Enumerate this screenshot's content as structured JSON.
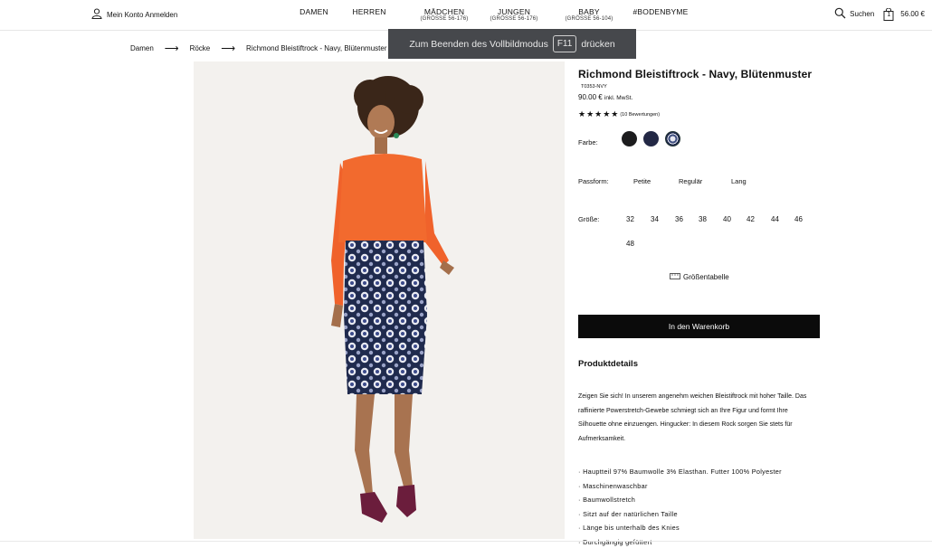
{
  "header": {
    "account_label": "Mein Konto Anmelden",
    "nav": [
      {
        "label": "DAMEN",
        "sub": ""
      },
      {
        "label": "HERREN",
        "sub": ""
      },
      {
        "label": "MÄDCHEN",
        "sub": "(GRÖSSE 56-176)"
      },
      {
        "label": "JUNGEN",
        "sub": "(GRÖSSE 56-176)"
      },
      {
        "label": "BABY",
        "sub": "(GRÖSSE 56-104)"
      },
      {
        "label": "#BODENBYME",
        "sub": ""
      }
    ],
    "search_label": "Suchen",
    "cart_count": "1",
    "cart_total": "56.00 €"
  },
  "breadcrumb": {
    "items": [
      "Damen",
      "Röcke",
      "Richmond Bleistiftrock - Navy, Blütenmuster"
    ],
    "separator": "⟶"
  },
  "toast": {
    "before": "Zum Beenden des Vollbildmodus",
    "key": "F11",
    "after": "drücken"
  },
  "product": {
    "title": "Richmond Bleistiftrock - Navy, Blütenmuster",
    "sku": "T0353-NVY",
    "price": "90.00 €",
    "vat": "inkl. MwSt.",
    "stars": "★★★★★",
    "rating": 5,
    "reviews": "(10 Bewertungen)",
    "color_label": "Farbe:",
    "colors": [
      "#1c1c1e",
      "#232845",
      "#3f4f80"
    ],
    "fit_label": "Passform:",
    "fits": [
      "Petite",
      "Regulär",
      "Lang"
    ],
    "size_label": "Größe:",
    "sizes": [
      "32",
      "34",
      "36",
      "38",
      "40",
      "42",
      "44",
      "46",
      "48"
    ],
    "size_chart": "Größentabelle",
    "add_to_cart": "In den Warenkorb",
    "details_title": "Produktdetails",
    "description": "Zeigen Sie sich! In unserem angenehm weichen Bleistiftrock mit hoher Taille. Das raffinierte Powerstretch-Gewebe schmiegt sich an Ihre Figur und formt Ihre Silhouette ohne einzuengen. Hingucker: In diesem Rock sorgen Sie stets für Aufmerksamkeit.",
    "bullets": [
      "Hauptteil 97% Baumwolle 3% Elasthan. Futter 100% Polyester",
      "Maschinenwaschbar",
      "Baumwollstretch",
      "Sitzt auf der natürlichen Taille",
      "Länge bis unterhalb des Knies",
      "Durchgängig gefüttert"
    ]
  }
}
